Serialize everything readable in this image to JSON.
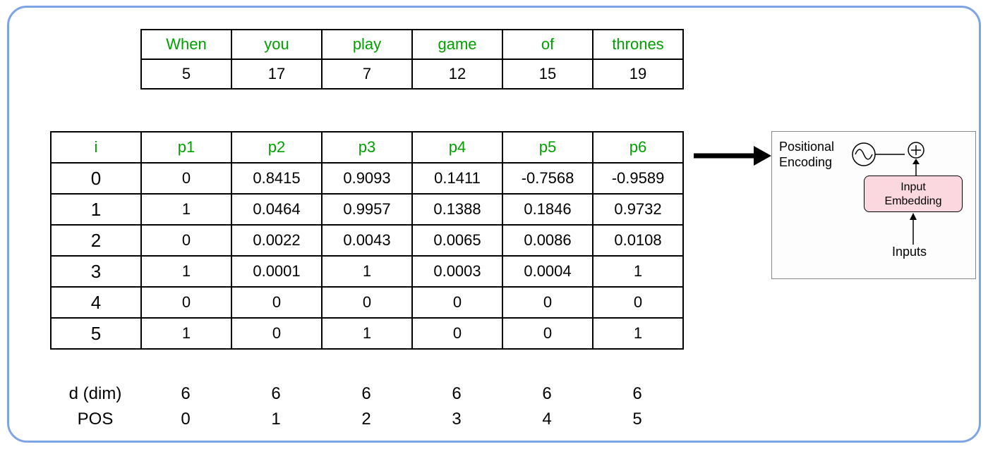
{
  "tokens": {
    "words": [
      "When",
      "you",
      "play",
      "game",
      "of",
      "thrones"
    ],
    "ids": [
      "5",
      "17",
      "7",
      "12",
      "15",
      "19"
    ]
  },
  "pe_table": {
    "headers": [
      "i",
      "p1",
      "p2",
      "p3",
      "p4",
      "p5",
      "p6"
    ],
    "rows": [
      [
        "0",
        "0",
        "0.8415",
        "0.9093",
        "0.1411",
        "-0.7568",
        "-0.9589"
      ],
      [
        "1",
        "1",
        "0.0464",
        "0.9957",
        "0.1388",
        "0.1846",
        "0.9732"
      ],
      [
        "2",
        "0",
        "0.0022",
        "0.0043",
        "0.0065",
        "0.0086",
        "0.0108"
      ],
      [
        "3",
        "1",
        "0.0001",
        "1",
        "0.0003",
        "0.0004",
        "1"
      ],
      [
        "4",
        "0",
        "0",
        "0",
        "0",
        "0",
        "0"
      ],
      [
        "5",
        "1",
        "0",
        "1",
        "0",
        "0",
        "1"
      ]
    ]
  },
  "footer": {
    "dim_label": "d (dim)",
    "dim_values": [
      "6",
      "6",
      "6",
      "6",
      "6",
      "6"
    ],
    "pos_label": "POS",
    "pos_values": [
      "0",
      "1",
      "2",
      "3",
      "4",
      "5"
    ]
  },
  "mini": {
    "pe_label_line1": "Positional",
    "pe_label_line2": "Encoding",
    "embed_line1": "Input",
    "embed_line2": "Embedding",
    "inputs_label": "Inputs"
  }
}
